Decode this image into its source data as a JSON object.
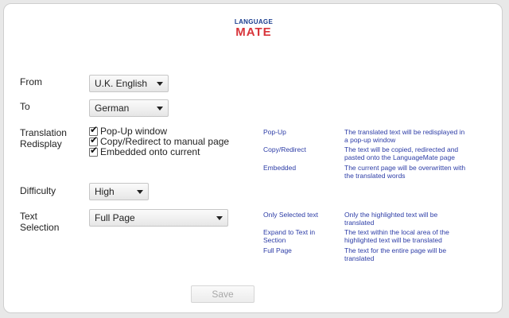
{
  "logo": {
    "top": "LANGUAGE",
    "bottom": "MATE"
  },
  "form": {
    "from": {
      "label": "From",
      "value": "U.K. English"
    },
    "to": {
      "label": "To",
      "value": "German"
    },
    "translation": {
      "label_line1": "Translation",
      "label_line2": "Redisplay",
      "options": [
        {
          "label": "Pop-Up window",
          "checked": true
        },
        {
          "label": "Copy/Redirect to manual page",
          "checked": true
        },
        {
          "label": "Embedded onto current",
          "checked": true
        }
      ]
    },
    "difficulty": {
      "label": "Difficulty",
      "value": "High"
    },
    "text_selection": {
      "label_line1": "Text",
      "label_line2": "Selection",
      "value": "Full Page"
    },
    "save_label": "Save"
  },
  "help": {
    "redisplay": [
      {
        "term": "Pop-Up",
        "desc_line1": "The translated text will be redisplayed in",
        "desc_line2": "a pop-up window"
      },
      {
        "term": "Copy/Redirect",
        "desc_line1": "The text will be copied, redirected and",
        "desc_line2": "pasted onto the LanguageMate page"
      },
      {
        "term": "Embedded",
        "desc_line1": "The current page will be overwritten with",
        "desc_line2": "the translated words"
      }
    ],
    "selection": [
      {
        "term_line1": "Only Selected text",
        "term_line2": "",
        "desc_line1": "Only the highlighted text will be",
        "desc_line2": "translated"
      },
      {
        "term_line1": "Expand to Text in",
        "term_line2": "Section",
        "desc_line1": "The text within the local area of the",
        "desc_line2": "highlighted text will be translated"
      },
      {
        "term_line1": "Full Page",
        "term_line2": "",
        "desc_line1": "The text for the entire page will be",
        "desc_line2": "translated"
      }
    ]
  },
  "colors": {
    "help_text": "#2c3ca6",
    "logo_blue": "#1a3d8f",
    "logo_red": "#d8343a"
  }
}
